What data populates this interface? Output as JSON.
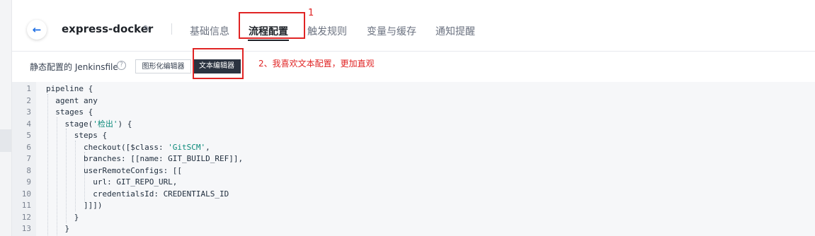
{
  "header": {
    "project_name": "express-docker",
    "tabs": [
      {
        "label": "基础信息",
        "active": false
      },
      {
        "label": "流程配置",
        "active": true
      },
      {
        "label": "触发规则",
        "active": false
      },
      {
        "label": "变量与缓存",
        "active": false
      },
      {
        "label": "通知提醒",
        "active": false
      }
    ]
  },
  "annotations": {
    "mark1": "1",
    "mark2": "2、我喜欢文本配置，更加直观"
  },
  "toolbar": {
    "static_label": "静态配置的 Jenkinsfile",
    "graphic_editor": "图形化编辑器",
    "text_editor": "文本编辑器"
  },
  "editor": {
    "lines": [
      {
        "n": "1",
        "code": "pipeline {"
      },
      {
        "n": "2",
        "code": "  agent any"
      },
      {
        "n": "3",
        "code": "  stages {"
      },
      {
        "n": "4",
        "code": "    stage('检出') {"
      },
      {
        "n": "5",
        "code": "      steps {"
      },
      {
        "n": "6",
        "code": "        checkout([$class: 'GitSCM',"
      },
      {
        "n": "7",
        "code": "        branches: [[name: GIT_BUILD_REF]],"
      },
      {
        "n": "8",
        "code": "        userRemoteConfigs: [["
      },
      {
        "n": "9",
        "code": "          url: GIT_REPO_URL,"
      },
      {
        "n": "10",
        "code": "          credentialsId: CREDENTIALS_ID"
      },
      {
        "n": "11",
        "code": "        ]]])"
      },
      {
        "n": "12",
        "code": "      }"
      },
      {
        "n": "13",
        "code": "    }"
      }
    ]
  },
  "colors": {
    "accent": "#1f6fe5",
    "annotation": "#e02424",
    "active_toggle": "#2b3340",
    "string": "#0b8a7a"
  }
}
